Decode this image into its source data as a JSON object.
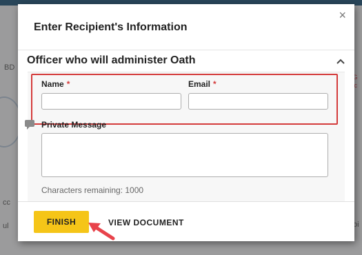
{
  "modal": {
    "title": "Enter Recipient's Information",
    "close_icon": "×"
  },
  "section": {
    "header": "Officer who will administer Oath",
    "collapse_icon": "^"
  },
  "form": {
    "name_label": "Name",
    "email_label": "Email",
    "required_marker": "*",
    "name_value": "",
    "email_value": "",
    "private_message_label": "Private Message",
    "private_message_value": "",
    "characters_remaining": "Characters remaining: 1000"
  },
  "footer": {
    "finish_label": "FINISH",
    "view_document_label": "VIEW DOCUMENT"
  },
  "colors": {
    "accent_button": "#f5c518",
    "highlight_border": "#d43a3a",
    "annotation_arrow": "#e8434b"
  },
  "background": {
    "fragment_1": "BD",
    "fragment_2": "cc",
    "fragment_3": "ul",
    "fragment_4": "oi",
    "red_fragment": "r\nIG\nxc"
  }
}
